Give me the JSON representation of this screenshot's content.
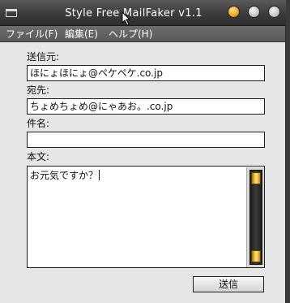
{
  "window": {
    "title": "Style Free MailFaker v1.1"
  },
  "menu": {
    "items": [
      {
        "label": "ファイル(F)"
      },
      {
        "label": "編集(E)"
      },
      {
        "label": "ヘルプ(H)"
      }
    ]
  },
  "form": {
    "from_label": "送信元:",
    "from_value": "ほにょほにょ@ペケペケ.co.jp",
    "to_label": "宛先:",
    "to_value": "ちょめちょめ@にゃあお。.co.jp",
    "subject_label": "件名:",
    "subject_value": "",
    "body_label": "本文:",
    "body_value": "お元気ですか？"
  },
  "buttons": {
    "send_label": "送信"
  },
  "icons": {
    "window": "window-icon",
    "minimize": "minimize-icon",
    "maximize": "maximize-icon",
    "close": "close-icon",
    "scroll_up": "scroll-up-icon",
    "scroll_down": "scroll-down-icon",
    "cursor": "mouse-cursor-icon"
  },
  "colors": {
    "titlebar": "#3c3c3c",
    "menubar": "#5f5f5f",
    "window_bg": "#e6e6e6",
    "accent_orange": "#e79b16",
    "scroll_gold": "#f7c940"
  }
}
